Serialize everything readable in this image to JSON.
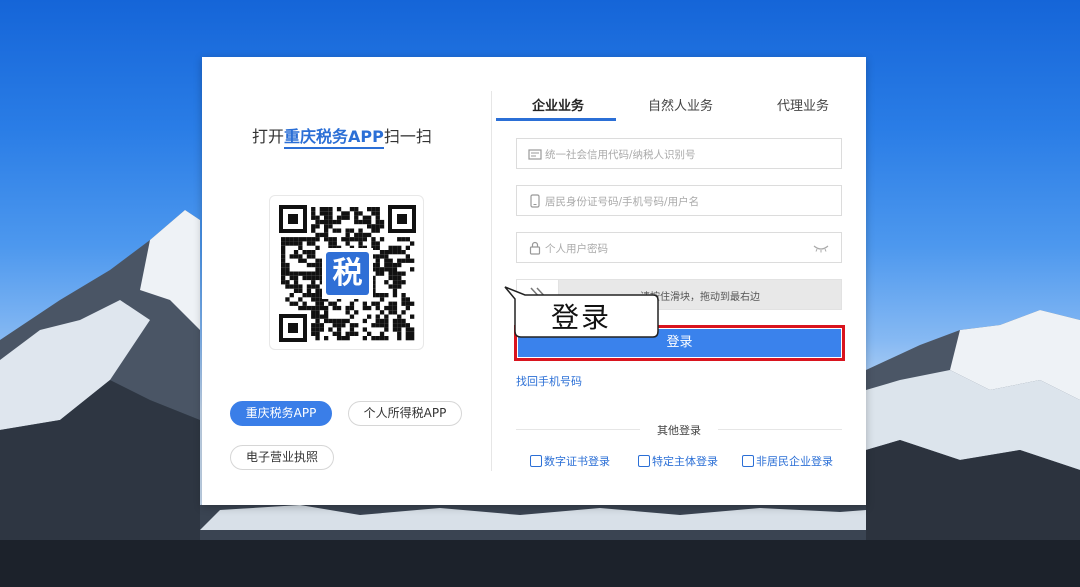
{
  "left_panel": {
    "title_prefix": "打开",
    "title_highlight": "重庆税务APP",
    "title_suffix": "扫一扫",
    "qr_center_char": "税",
    "app_buttons": [
      "重庆税务APP",
      "个人所得税APP",
      "电子营业执照"
    ]
  },
  "tabs": [
    "企业业务",
    "自然人业务",
    "代理业务"
  ],
  "form": {
    "code_placeholder": "统一社会信用代码/纳税人识别号",
    "id_placeholder": "居民身份证号码/手机号码/用户名",
    "password_placeholder": "个人用户密码",
    "slider_text": "请按住滑块，拖动到最右边",
    "login_label": "登录",
    "forgot_link": "找回手机号码"
  },
  "callout": {
    "text": "登录"
  },
  "other_login": {
    "title": "其他登录",
    "options": [
      "数字证书登录",
      "特定主体登录",
      "非居民企业登录"
    ]
  },
  "colors": {
    "accent": "#3a82ec",
    "highlight_border": "#d9141e"
  }
}
